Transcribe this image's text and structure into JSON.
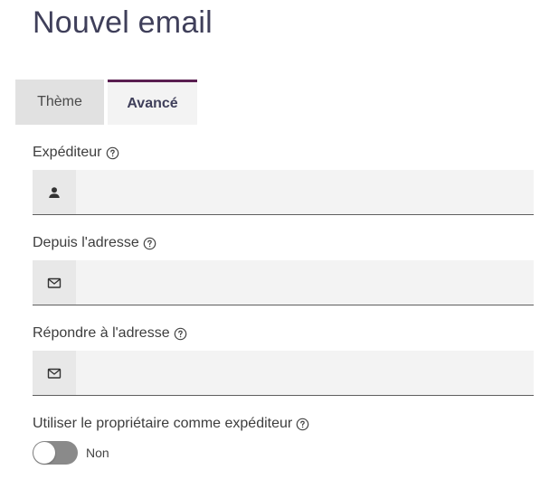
{
  "page": {
    "title": "Nouvel email"
  },
  "tabs": [
    {
      "label": "Thème",
      "active": false
    },
    {
      "label": "Avancé",
      "active": true
    }
  ],
  "fields": {
    "sender": {
      "label": "Expéditeur",
      "icon": "user-icon",
      "value": "",
      "placeholder": ""
    },
    "from_address": {
      "label": "Depuis l'adresse",
      "icon": "envelope-icon",
      "value": "",
      "placeholder": ""
    },
    "reply_to": {
      "label": "Répondre à l'adresse",
      "icon": "envelope-icon",
      "value": "",
      "placeholder": ""
    }
  },
  "owner_as_sender": {
    "label": "Utiliser le propriétaire comme expéditeur",
    "state_label": "Non",
    "enabled": false
  },
  "colors": {
    "accent": "#5a1e50",
    "title": "#3f3f5a",
    "input_background": "#f3f3f3",
    "toggle_off": "#8a8a8a"
  }
}
